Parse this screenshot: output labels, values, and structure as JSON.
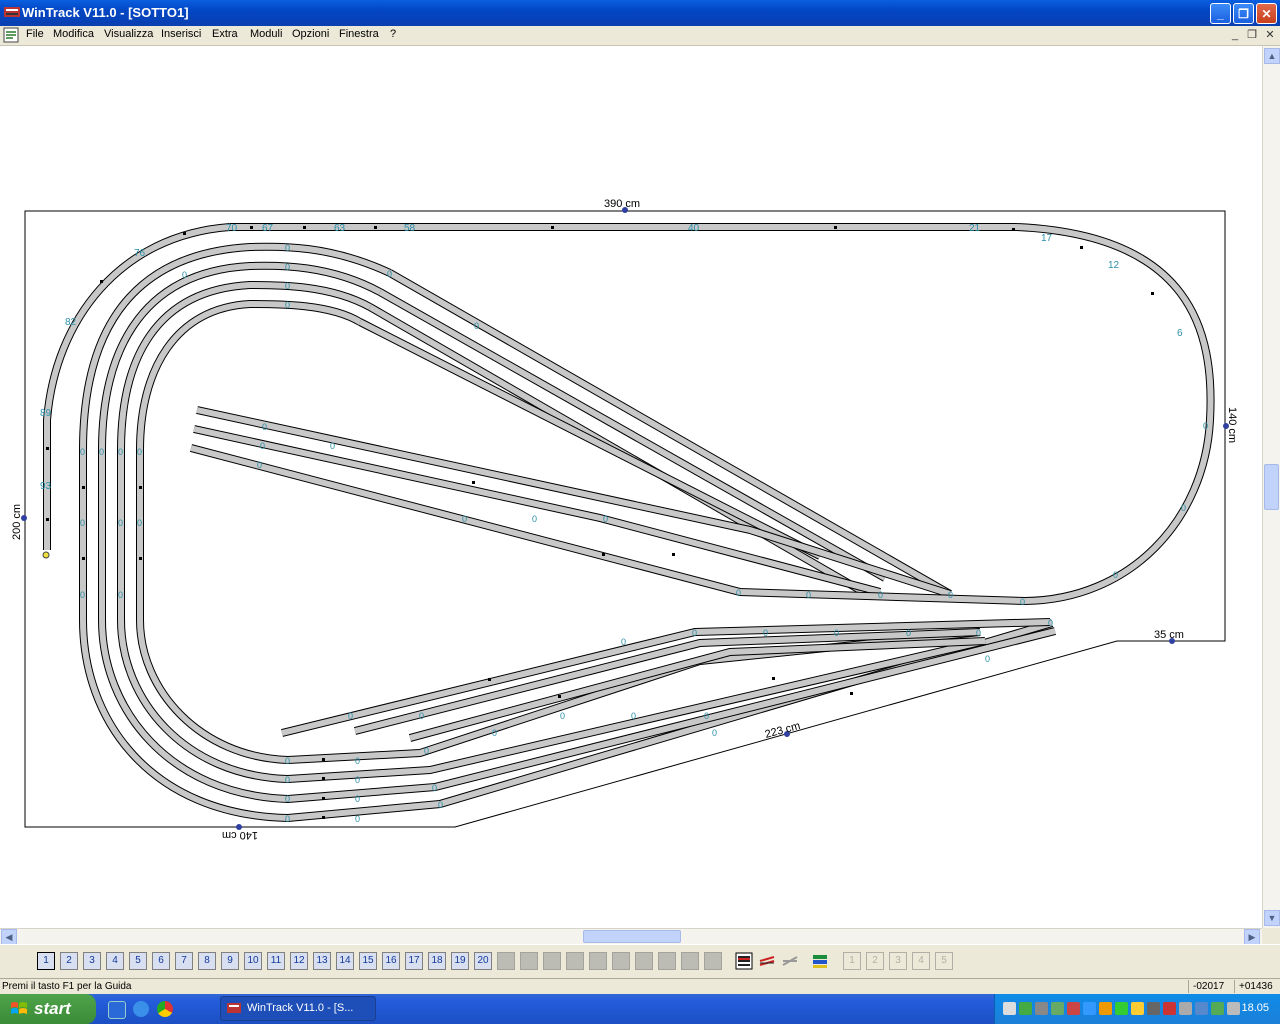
{
  "window": {
    "title": "WinTrack  V11.0 - [SOTTO1]",
    "minimize_glyph": "_",
    "maximize_glyph": "❐",
    "close_glyph": "✕"
  },
  "menu": {
    "items": [
      "File",
      "Modifica",
      "Visualizza",
      "Inserisci",
      "Extra",
      "Moduli",
      "Opzioni",
      "Finestra",
      "?"
    ]
  },
  "layout": {
    "dimensions": {
      "top": "390 cm",
      "left": "200 cm",
      "right": "140 cm",
      "right_step": "35 cm",
      "bottom_diagonal": "223 cm",
      "bottom": "140 cm"
    },
    "track_numbers": [
      "70",
      "67",
      "63",
      "58",
      "40",
      "21",
      "17",
      "12",
      "6",
      "76",
      "82",
      "89",
      "93"
    ],
    "switch_label": "0",
    "icon": "layout-track-plan"
  },
  "layers": {
    "numbers": [
      "1",
      "2",
      "3",
      "4",
      "5",
      "6",
      "7",
      "8",
      "9",
      "10",
      "11",
      "12",
      "13",
      "14",
      "15",
      "16",
      "17",
      "18",
      "19",
      "20"
    ],
    "selected": "1",
    "extra_icons": [
      "layer-stack-icon",
      "layer-red-icon",
      "layer-gray-icon",
      "layer-manager-icon"
    ],
    "view_buttons": [
      "1",
      "2",
      "3",
      "4",
      "5"
    ]
  },
  "status": {
    "message": "Premi il tasto F1 per la Guida",
    "coord_x": "-02017",
    "coord_y": "+01436"
  },
  "taskbar": {
    "start_label": "start",
    "task_label": "WinTrack  V11.0 - [S...",
    "clock": "18.05"
  },
  "colors": {
    "track_fill": "#c8c8c8",
    "track_stroke": "#000000",
    "label_color": "#2a8fa8",
    "taskbar_blue": "#245edb",
    "start_green": "#3a8c36"
  }
}
